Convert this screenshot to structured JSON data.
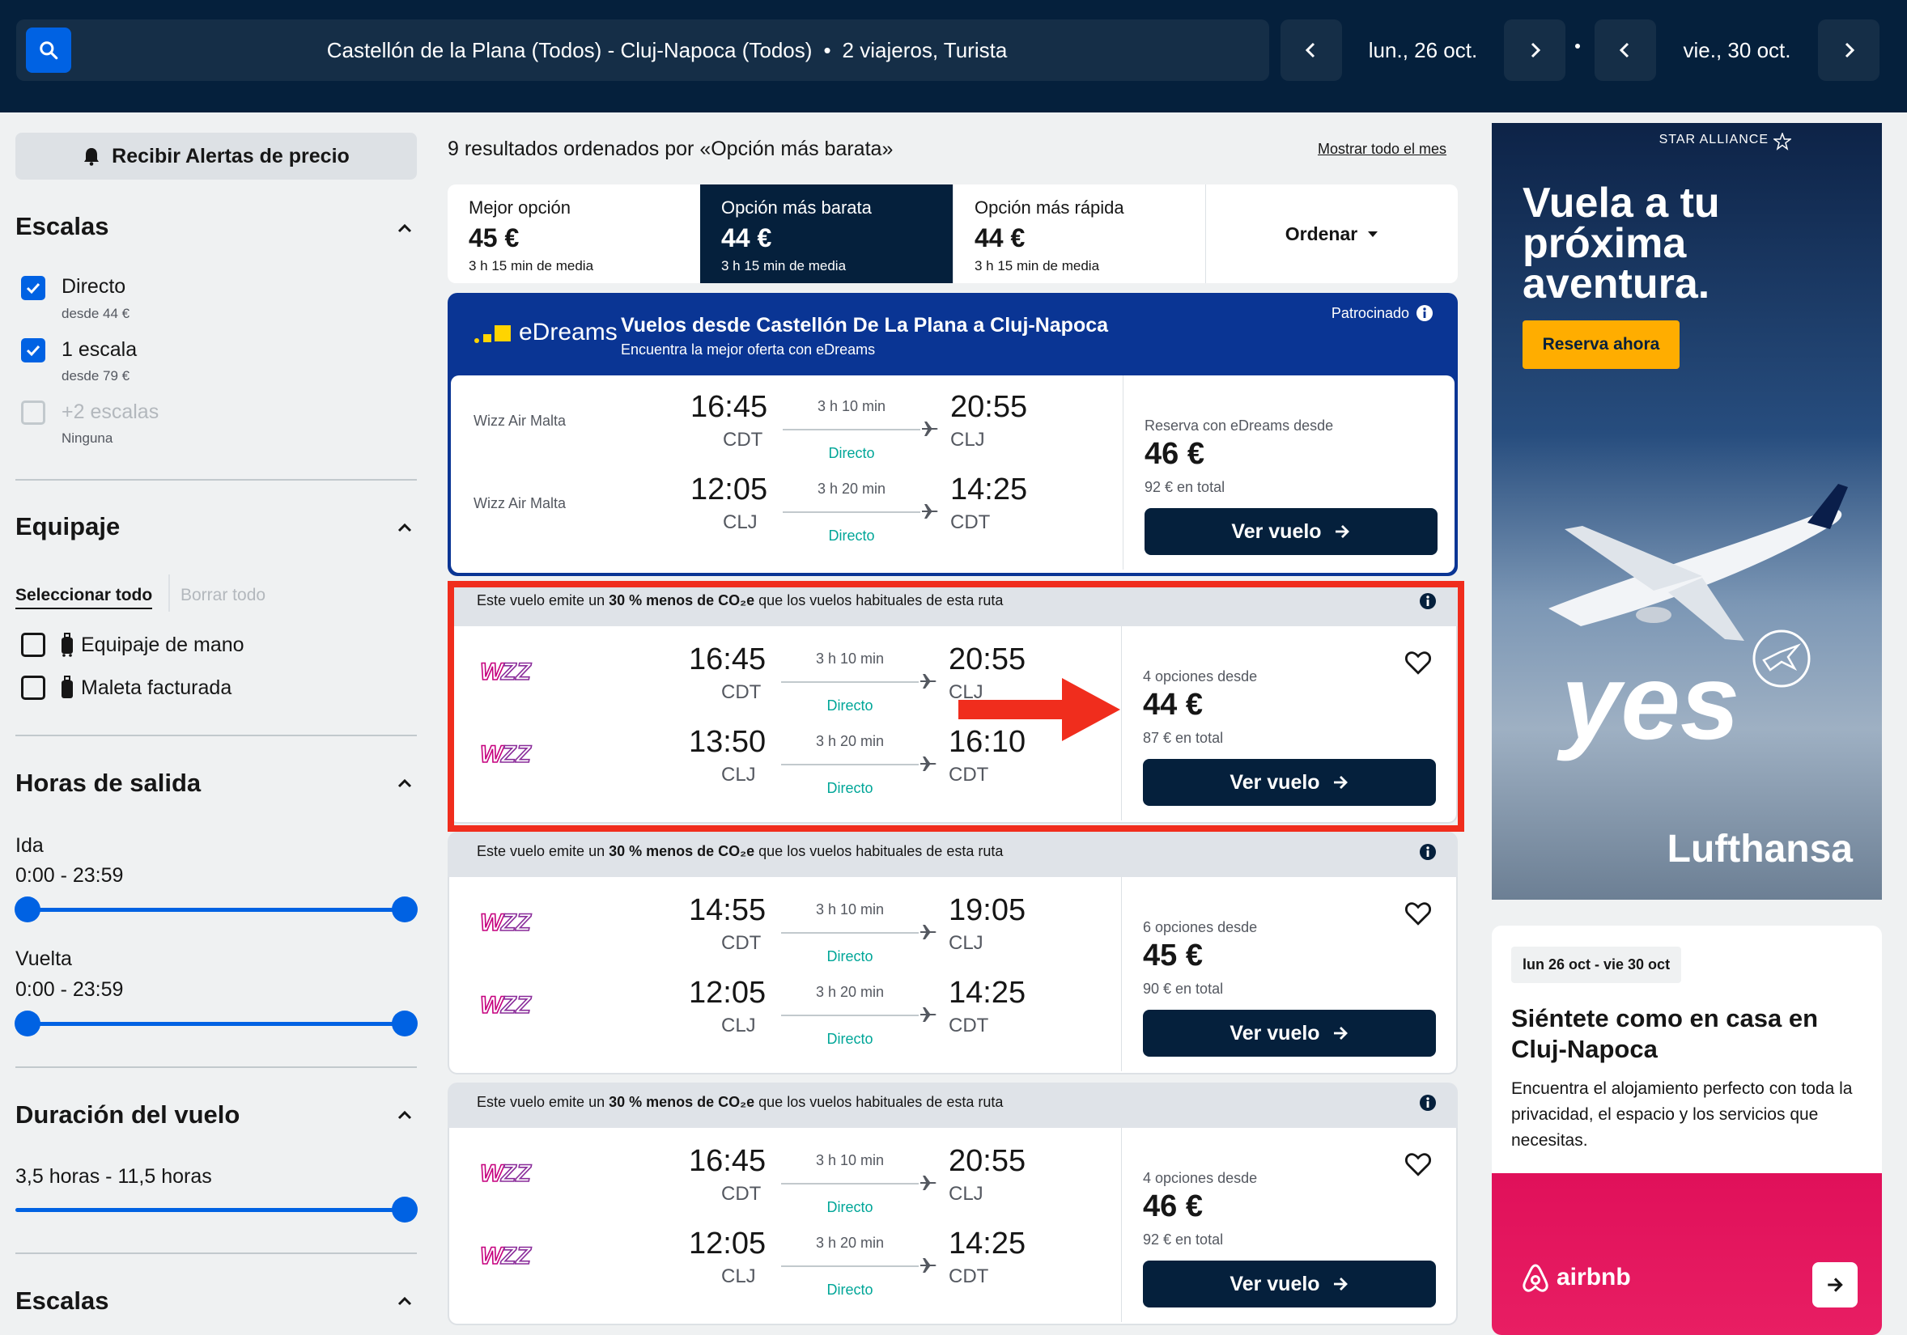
{
  "header": {
    "route": "Castellón de la Plana (Todos) - Cluj-Napoca (Todos)",
    "travellers": "2 viajeros, Turista",
    "depart_date": "lun., 26 oct.",
    "return_date": "vie., 30 oct."
  },
  "sidebar": {
    "alert_label": "Recibir Alertas de precio",
    "stops_title": "Escalas",
    "stops": [
      {
        "label": "Directo",
        "sub": "desde 44 €",
        "checked": true
      },
      {
        "label": "1 escala",
        "sub": "desde 79 €",
        "checked": true
      },
      {
        "label": "+2 escalas",
        "sub": "Ninguna",
        "checked": false
      }
    ],
    "baggage_title": "Equipaje",
    "select_all": "Seleccionar todo",
    "clear_all": "Borrar todo",
    "baggage": [
      {
        "label": "Equipaje de mano"
      },
      {
        "label": "Maleta facturada"
      }
    ],
    "times_title": "Horas de salida",
    "outbound_label": "Ida",
    "outbound_range": "0:00 - 23:59",
    "return_label": "Vuelta",
    "return_range": "0:00 - 23:59",
    "duration_title": "Duración del vuelo",
    "duration_range": "3,5 horas - 11,5 horas",
    "stops_title_2": "Escalas"
  },
  "main": {
    "results_count": "9 resultados ordenados por «Opción más barata»",
    "month_link": "Mostrar todo el mes",
    "tabs": [
      {
        "label": "Mejor opción",
        "price": "45 €",
        "time": "3 h 15 min de media"
      },
      {
        "label": "Opción más barata",
        "price": "44 €",
        "time": "3 h 15 min de media"
      },
      {
        "label": "Opción más rápida",
        "price": "44 €",
        "time": "3 h 15 min de media"
      }
    ],
    "sort_label": "Ordenar",
    "sponsor": {
      "brand": "eDreams",
      "title": "Vuelos desde Castellón De La Plana a Cluj-Napoca",
      "subtitle": "Encuentra la mejor oferta con eDreams",
      "tag": "Patrocinado",
      "legs": [
        {
          "airline": "Wizz Air Malta",
          "dep": "16:45",
          "dep_ap": "CDT",
          "dur": "3 h 10 min",
          "stop": "Directo",
          "arr": "20:55",
          "arr_ap": "CLJ"
        },
        {
          "airline": "Wizz Air Malta",
          "dep": "12:05",
          "dep_ap": "CLJ",
          "dur": "3 h 20 min",
          "stop": "Directo",
          "arr": "14:25",
          "arr_ap": "CDT"
        }
      ],
      "from_label": "Reserva con eDreams desde",
      "price": "46 €",
      "total": "92 € en total",
      "cta": "Ver vuelo"
    },
    "eco_note_pre": "Este vuelo emite un ",
    "eco_note_bold": "30 % menos de CO₂e",
    "eco_note_post": " que los vuelos habituales de esta ruta",
    "results": [
      {
        "legs": [
          {
            "dep": "16:45",
            "dep_ap": "CDT",
            "dur": "3 h 10 min",
            "stop": "Directo",
            "arr": "20:55",
            "arr_ap": "CLJ"
          },
          {
            "dep": "13:50",
            "dep_ap": "CLJ",
            "dur": "3 h 20 min",
            "stop": "Directo",
            "arr": "16:10",
            "arr_ap": "CDT"
          }
        ],
        "options": "4 opciones desde",
        "price": "44 €",
        "total": "87 € en total",
        "cta": "Ver vuelo"
      },
      {
        "legs": [
          {
            "dep": "14:55",
            "dep_ap": "CDT",
            "dur": "3 h 10 min",
            "stop": "Directo",
            "arr": "19:05",
            "arr_ap": "CLJ"
          },
          {
            "dep": "12:05",
            "dep_ap": "CLJ",
            "dur": "3 h 20 min",
            "stop": "Directo",
            "arr": "14:25",
            "arr_ap": "CDT"
          }
        ],
        "options": "6 opciones desde",
        "price": "45 €",
        "total": "90 € en total",
        "cta": "Ver vuelo"
      },
      {
        "legs": [
          {
            "dep": "16:45",
            "dep_ap": "CDT",
            "dur": "3 h 10 min",
            "stop": "Directo",
            "arr": "20:55",
            "arr_ap": "CLJ"
          },
          {
            "dep": "12:05",
            "dep_ap": "CLJ",
            "dur": "3 h 20 min",
            "stop": "Directo",
            "arr": "14:25",
            "arr_ap": "CDT"
          }
        ],
        "options": "4 opciones desde",
        "price": "46 €",
        "total": "92 € en total",
        "cta": "Ver vuelo"
      }
    ]
  },
  "ads": {
    "lufthansa": {
      "alliance": "STAR ALLIANCE",
      "headline": "Vuela a tu próxima aventura.",
      "cta": "Reserva ahora",
      "slogan": "yes",
      "brand": "Lufthansa"
    },
    "airbnb": {
      "dates": "lun 26 oct - vie 30 oct",
      "title": "Siéntete como en casa en Cluj-Napoca",
      "desc": "Encuentra el alojamiento perfecto con toda la privacidad, el espacio y los servicios que necesitas.",
      "brand": "airbnb"
    }
  },
  "colors": {
    "header": "#05203c",
    "accent": "#0062e3",
    "highlight": "#f02d1d",
    "eco_green": "#00a698"
  }
}
